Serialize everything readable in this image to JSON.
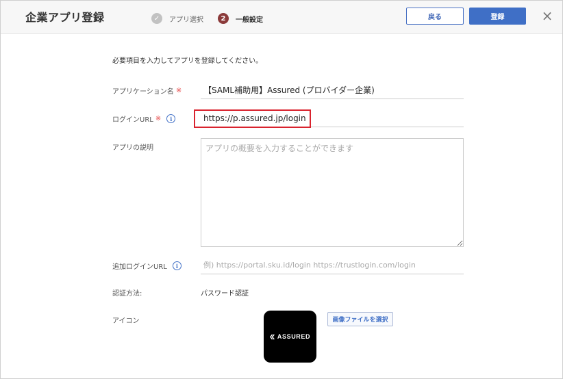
{
  "header": {
    "title": "企業アプリ登録",
    "steps": [
      {
        "number": "✓",
        "label": "アプリ選択",
        "state": "done"
      },
      {
        "number": "2",
        "label": "一般設定",
        "state": "active"
      }
    ],
    "back_label": "戻る",
    "register_label": "登録",
    "close_icon": "×"
  },
  "form": {
    "intro": "必要項目を入力してアプリを登録してください。",
    "required_mark": "※",
    "info_icon": "i",
    "app_name": {
      "label": "アプリケーション名",
      "value": "【SAML補助用】Assured (プロバイダー企業)"
    },
    "login_url": {
      "label": "ログインURL",
      "value": "https://p.assured.jp/login"
    },
    "description": {
      "label": "アプリの説明",
      "placeholder": "アプリの概要を入力することができます"
    },
    "additional_url": {
      "label": "追加ログインURL",
      "placeholder": "例) https://portal.sku.id/login https://trustlogin.com/login"
    },
    "auth_method": {
      "label": "認証方法:",
      "value": "パスワード認証"
    },
    "icon": {
      "label": "アイコン",
      "logo_text": "ASSURED",
      "select_label": "画像ファイルを選択"
    }
  },
  "colors": {
    "accent": "#3f6fc6",
    "required": "#e64a4a",
    "highlight": "#d9232e",
    "step_active": "#8b3a3a"
  }
}
